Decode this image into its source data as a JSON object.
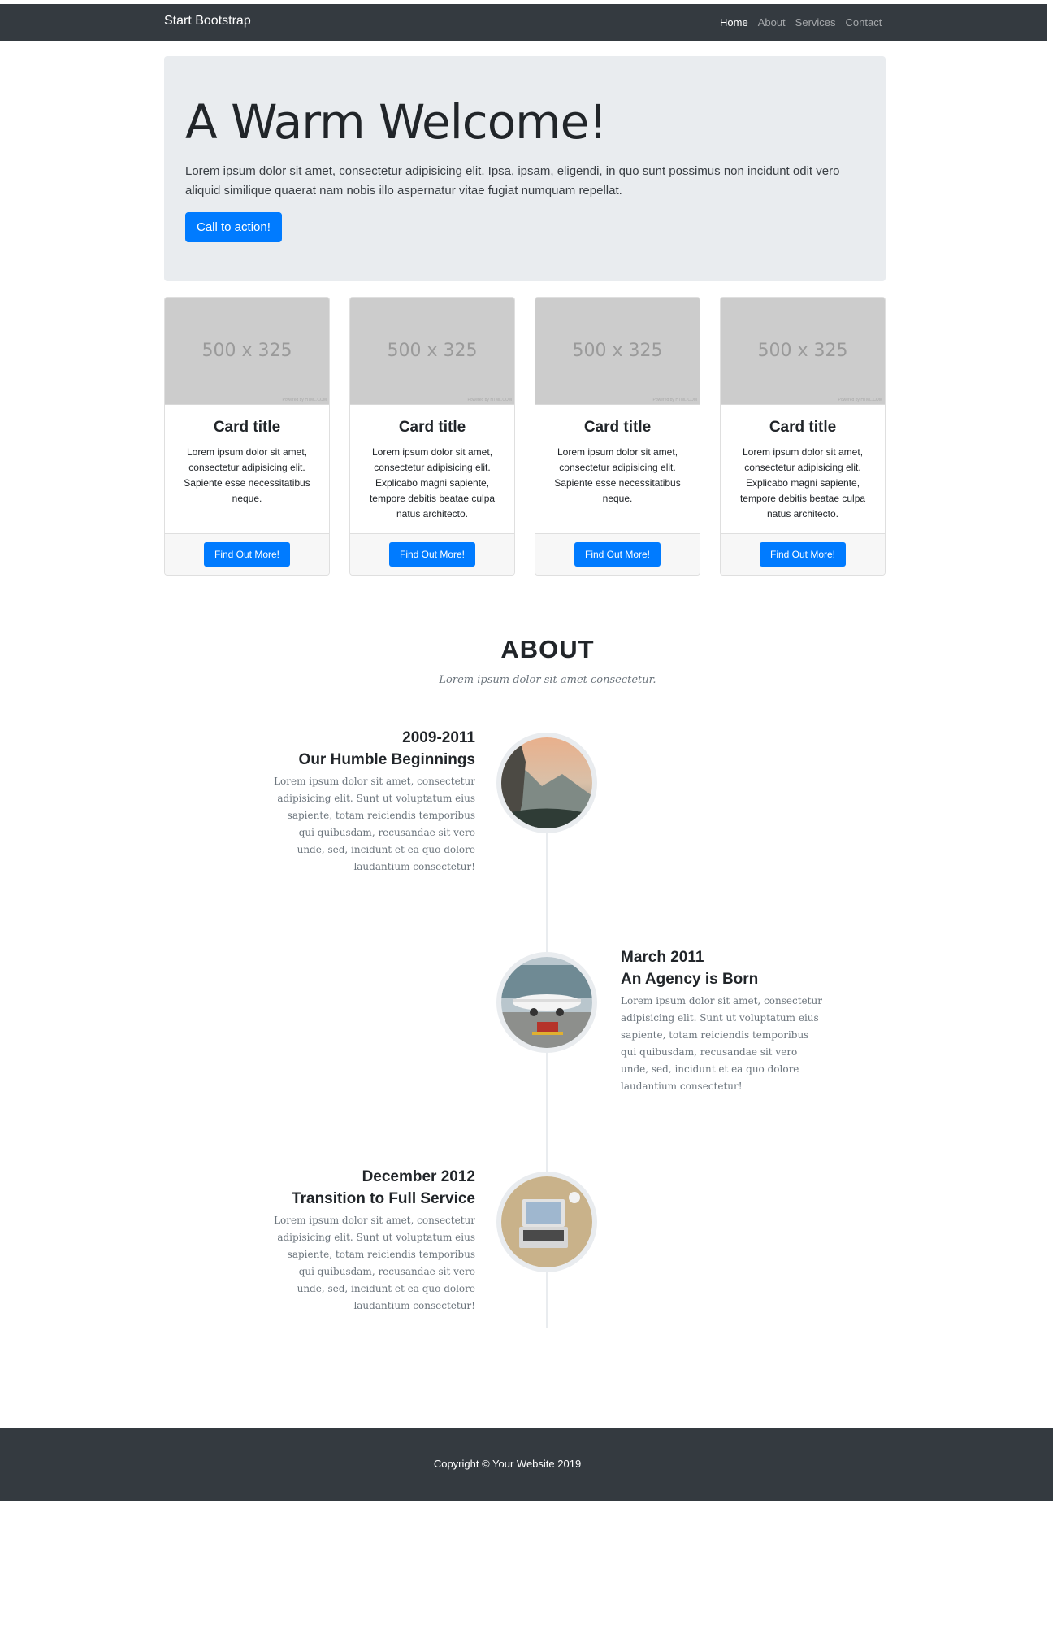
{
  "navbar": {
    "brand": "Start Bootstrap",
    "links": [
      "Home",
      "About",
      "Services",
      "Contact"
    ],
    "active": "Home"
  },
  "jumbotron": {
    "title": "A Warm Welcome!",
    "lead": "Lorem ipsum dolor sit amet, consectetur adipisicing elit. Ipsa, ipsam, eligendi, in quo sunt possimus non incidunt odit vero aliquid similique quaerat nam nobis illo aspernatur vitae fugiat numquam repellat.",
    "button": "Call to action!"
  },
  "cards": [
    {
      "image": "500 x 325",
      "powered": "Powered by HTML.COM",
      "title": "Card title",
      "text": "Lorem ipsum dolor sit amet, consectetur adipisicing elit. Sapiente esse necessitatibus neque.",
      "button": "Find Out More!"
    },
    {
      "image": "500 x 325",
      "powered": "Powered by HTML.COM",
      "title": "Card title",
      "text": "Lorem ipsum dolor sit amet, consectetur adipisicing elit. Explicabo magni sapiente, tempore debitis beatae culpa natus architecto.",
      "button": "Find Out More!"
    },
    {
      "image": "500 x 325",
      "powered": "Powered by HTML.COM",
      "title": "Card title",
      "text": "Lorem ipsum dolor sit amet, consectetur adipisicing elit. Sapiente esse necessitatibus neque.",
      "button": "Find Out More!"
    },
    {
      "image": "500 x 325",
      "powered": "Powered by HTML.COM",
      "title": "Card title",
      "text": "Lorem ipsum dolor sit amet, consectetur adipisicing elit. Explicabo magni sapiente, tempore debitis beatae culpa natus architecto.",
      "button": "Find Out More!"
    }
  ],
  "about": {
    "heading": "ABOUT",
    "subheading": "Lorem ipsum dolor sit amet consectetur.",
    "timeline": [
      {
        "date": "2009-2011",
        "title": "Our Humble Beginnings",
        "text": "Lorem ipsum dolor sit amet, consectetur adipisicing elit. Sunt ut voluptatum eius sapiente, totam reiciendis temporibus qui quibusdam, recusandae sit vero unde, sed, incidunt et ea quo dolore laudantium consectetur!",
        "image": "mountain-landscape"
      },
      {
        "date": "March 2011",
        "title": "An Agency is Born",
        "text": "Lorem ipsum dolor sit amet, consectetur adipisicing elit. Sunt ut voluptatum eius sapiente, totam reiciendis temporibus qui quibusdam, recusandae sit vero unde, sed, incidunt et ea quo dolore laudantium consectetur!",
        "image": "airplane-at-gate"
      },
      {
        "date": "December 2012",
        "title": "Transition to Full Service",
        "text": "Lorem ipsum dolor sit amet, consectetur adipisicing elit. Sunt ut voluptatum eius sapiente, totam reiciendis temporibus qui quibusdam, recusandae sit vero unde, sed, incidunt et ea quo dolore laudantium consectetur!",
        "image": "laptop-on-desk"
      }
    ]
  },
  "footer": {
    "copyright": "Copyright © Your Website 2019"
  },
  "colors": {
    "navbar": "#343a40",
    "primary": "#007bff",
    "jumbotron": "#e9ecef"
  }
}
